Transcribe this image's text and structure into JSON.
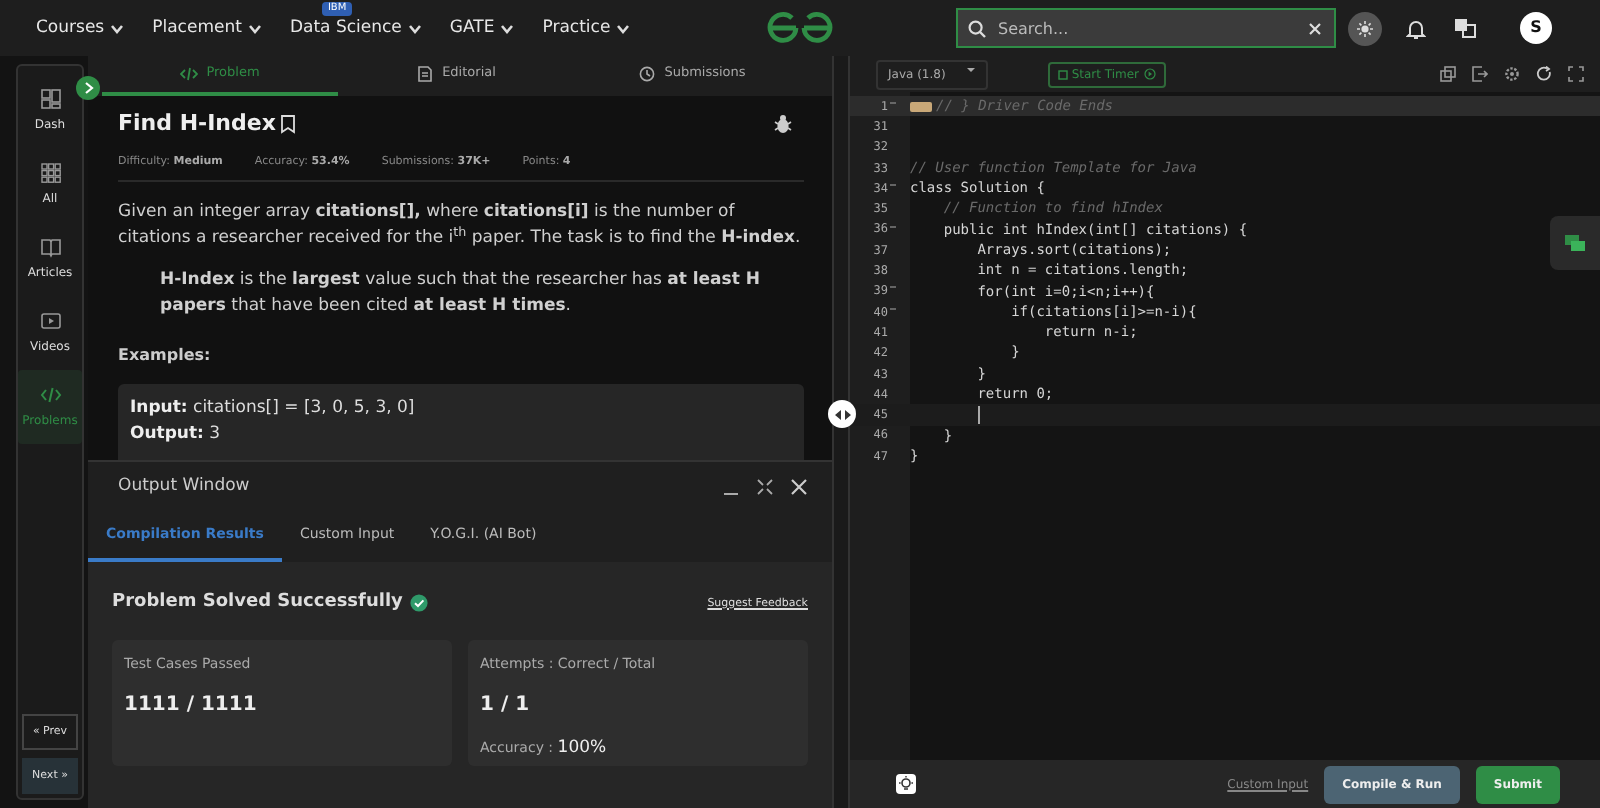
{
  "navbar": {
    "menus": [
      {
        "label": "Courses"
      },
      {
        "label": "Placement"
      },
      {
        "label": "Data Science",
        "badge": "IBM"
      },
      {
        "label": "GATE"
      },
      {
        "label": "Practice"
      }
    ],
    "search": {
      "placeholder": "Search..."
    },
    "avatar": "S"
  },
  "sidebar": {
    "items": [
      {
        "label": "Dash",
        "selected": false
      },
      {
        "label": "All",
        "selected": false
      },
      {
        "label": "Articles",
        "selected": false
      },
      {
        "label": "Videos",
        "selected": false
      },
      {
        "label": "Problems",
        "selected": true
      }
    ],
    "prev": "« Prev",
    "next": "Next »"
  },
  "problem_tabs": [
    {
      "label": "Problem",
      "selected": true
    },
    {
      "label": "Editorial",
      "selected": false
    },
    {
      "label": "Submissions",
      "selected": false
    }
  ],
  "problem": {
    "title": "Find H-Index",
    "meta": [
      {
        "label": "Difficulty:",
        "value": "Medium"
      },
      {
        "label": "Accuracy:",
        "value": "53.4%"
      },
      {
        "label": "Submissions:",
        "value": "37K+"
      },
      {
        "label": "Points:",
        "value": "4"
      }
    ],
    "statement": "Given an integer array **citations[],** where **citations[i]** is the number of citations a researcher received for the i$^{th}$ paper. The task is to find the **H-index**.",
    "definition": "**H-Index** is the **largest** value such that the researcher has **at least H papers** that have been cited **at least H times**.",
    "examples_heading": "Examples:",
    "example": [
      {
        "label": "Input:",
        "value": "citations[] = [3, 0, 5, 3, 0]"
      },
      {
        "label": "Output:",
        "value": "3"
      }
    ]
  },
  "output_window": {
    "title": "Output Window",
    "tabs": [
      {
        "label": "Compilation Results",
        "selected": true
      },
      {
        "label": "Custom Input",
        "selected": false
      },
      {
        "label": "Y.O.G.I. (AI Bot)",
        "selected": false
      }
    ],
    "status": "Problem Solved Successfully",
    "feedback_link": "Suggest Feedback",
    "cards": [
      {
        "title": "Test Cases Passed",
        "value": "1111 / 1111"
      },
      {
        "title": "Attempts : Correct / Total",
        "value": "1 / 1",
        "note_label": "Accuracy :",
        "note_value": "100%"
      }
    ]
  },
  "editor": {
    "language": "Java (1.8)",
    "timer_button": "Start Timer",
    "lines": [
      {
        "number": "1",
        "kind": "comment",
        "code": "// } Driver Code Ends",
        "folded": true,
        "foldable": true,
        "active": false
      },
      {
        "number": "31",
        "folded": false,
        "foldable": false,
        "active": false
      },
      {
        "number": "32",
        "folded": false,
        "foldable": false,
        "active": false
      },
      {
        "number": "33",
        "kind": "comment",
        "code": "// User function Template for Java",
        "folded": false,
        "foldable": false,
        "active": false
      },
      {
        "number": "34",
        "kind": "code",
        "code": "class Solution {",
        "folded": false,
        "foldable": true,
        "active": false
      },
      {
        "number": "35",
        "kind": "comment",
        "code": "    // Function to find hIndex",
        "folded": false,
        "foldable": false,
        "active": false
      },
      {
        "number": "36",
        "kind": "code",
        "code": "    public int hIndex(int[] citations) {",
        "folded": false,
        "foldable": true,
        "active": false
      },
      {
        "number": "37",
        "kind": "code",
        "code": "        Arrays.sort(citations);",
        "folded": false,
        "foldable": false,
        "active": false
      },
      {
        "number": "38",
        "kind": "code",
        "code": "        int n = citations.length;",
        "folded": false,
        "foldable": false,
        "active": false
      },
      {
        "number": "39",
        "kind": "code",
        "code": "        for(int i=0;i<n;i++){",
        "folded": false,
        "foldable": true,
        "active": false
      },
      {
        "number": "40",
        "kind": "code",
        "code": "            if(citations[i]>=n-i){",
        "folded": false,
        "foldable": true,
        "active": false
      },
      {
        "number": "41",
        "kind": "code",
        "code": "                return n-i;",
        "folded": false,
        "foldable": false,
        "active": false
      },
      {
        "number": "42",
        "kind": "code",
        "code": "            }",
        "folded": false,
        "foldable": false,
        "active": false
      },
      {
        "number": "43",
        "kind": "code",
        "code": "        }",
        "folded": false,
        "foldable": false,
        "active": false
      },
      {
        "number": "44",
        "kind": "code",
        "code": "        return 0;",
        "folded": false,
        "foldable": false,
        "active": false
      },
      {
        "number": "45",
        "folded": false,
        "foldable": false,
        "active": true
      },
      {
        "number": "46",
        "kind": "code",
        "code": "    }",
        "folded": false,
        "foldable": false,
        "active": false
      },
      {
        "number": "47",
        "kind": "code",
        "code": "}",
        "folded": false,
        "foldable": false,
        "active": false
      }
    ],
    "custom_input_link": "Custom Input",
    "compile_button": "Compile & Run",
    "submit_button": "Submit"
  }
}
